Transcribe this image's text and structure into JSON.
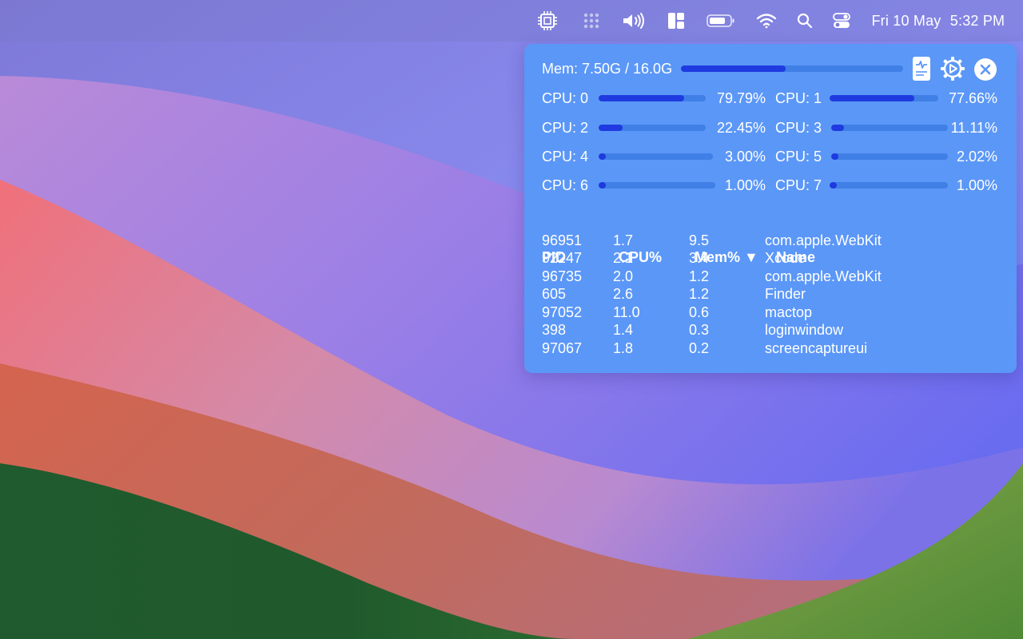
{
  "menubar": {
    "date": "Fri 10 May",
    "time": "5:32 PM",
    "icons": [
      "cpu-chip-icon",
      "dots-grid-icon",
      "volume-icon",
      "window-layout-icon",
      "battery-icon",
      "wifi-icon",
      "search-icon",
      "control-center-icon"
    ]
  },
  "panel": {
    "memory": {
      "label": "Mem: 7.50G / 16.0G",
      "fraction": 0.47
    },
    "toolbar_icons": [
      "activity-report-icon",
      "settings-gear-icon",
      "close-icon"
    ],
    "cpus": [
      {
        "label": "CPU: 0",
        "percent": "79.79%",
        "value": 0.7979
      },
      {
        "label": "CPU: 1",
        "percent": "77.66%",
        "value": 0.7766
      },
      {
        "label": "CPU: 2",
        "percent": "22.45%",
        "value": 0.2245
      },
      {
        "label": "CPU: 3",
        "percent": "11.11%",
        "value": 0.1111
      },
      {
        "label": "CPU: 4",
        "percent": "3.00%",
        "value": 0.03
      },
      {
        "label": "CPU: 5",
        "percent": "2.02%",
        "value": 0.0202
      },
      {
        "label": "CPU: 6",
        "percent": "1.00%",
        "value": 0.01
      },
      {
        "label": "CPU: 7",
        "percent": "1.00%",
        "value": 0.01
      }
    ],
    "table": {
      "headers": {
        "pid": "PID",
        "cpu": "CPU%",
        "mem": "Mem%",
        "sort_indicator": "▼",
        "name": "Name"
      },
      "rows": [
        {
          "pid": "96951",
          "cpu": "1.7",
          "mem": "9.5",
          "name": "com.apple.WebKit"
        },
        {
          "pid": "92247",
          "cpu": "2.1",
          "mem": "3.4",
          "name": "Xcode"
        },
        {
          "pid": "96735",
          "cpu": "2.0",
          "mem": "1.2",
          "name": "com.apple.WebKit"
        },
        {
          "pid": "605",
          "cpu": "2.6",
          "mem": "1.2",
          "name": "Finder"
        },
        {
          "pid": "97052",
          "cpu": "11.0",
          "mem": "0.6",
          "name": "mactop"
        },
        {
          "pid": "398",
          "cpu": "1.4",
          "mem": "0.3",
          "name": "loginwindow"
        },
        {
          "pid": "97067",
          "cpu": "1.8",
          "mem": "0.2",
          "name": "screencaptureui"
        }
      ]
    }
  },
  "colors": {
    "panel_bg": "#5b97f7",
    "bar_track": "#3f7fe6",
    "bar_fill": "#1f3ae0"
  }
}
